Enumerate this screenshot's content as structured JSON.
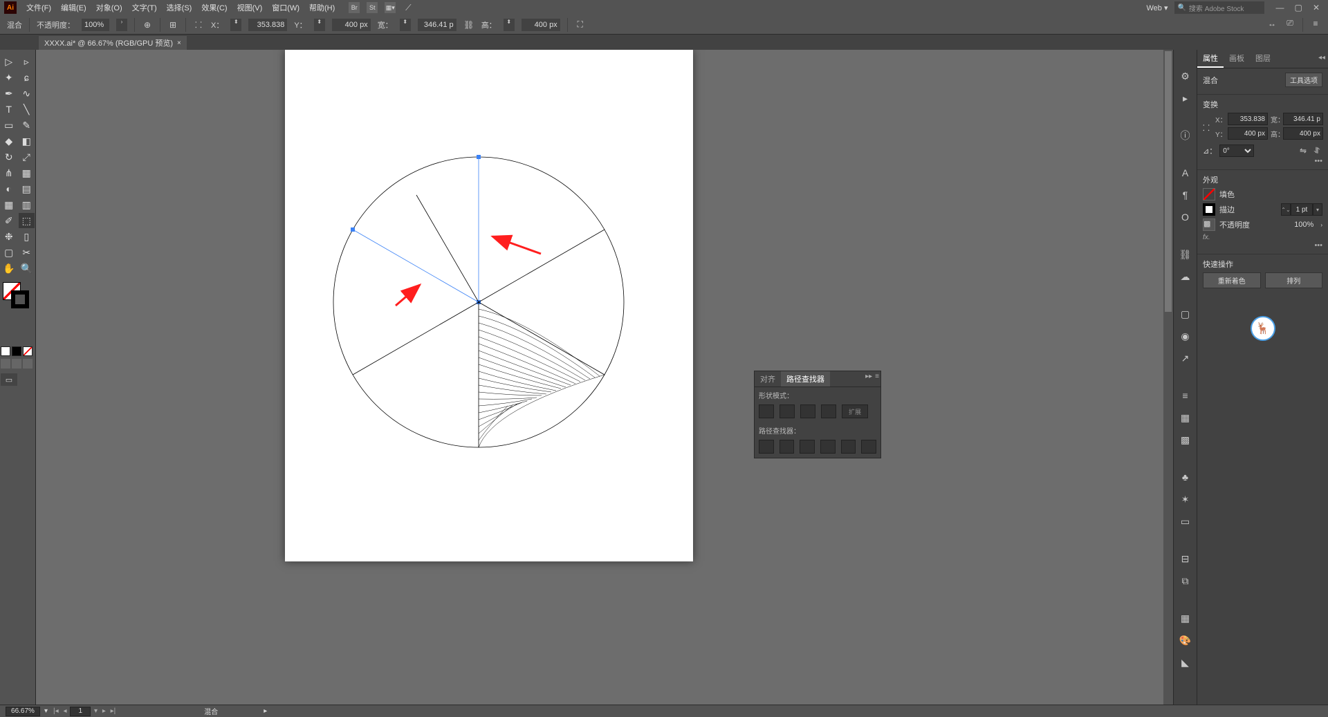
{
  "menubar": [
    "文件(F)",
    "编辑(E)",
    "对象(O)",
    "文字(T)",
    "选择(S)",
    "效果(C)",
    "视图(V)",
    "窗口(W)",
    "帮助(H)"
  ],
  "titlebar_right": {
    "workspace": "Web",
    "search_placeholder": "搜索 Adobe Stock"
  },
  "options": {
    "tool": "混合",
    "opacity_label": "不透明度：",
    "opacity_value": "100%",
    "x_label": "X：",
    "x": "353.838",
    "y_label": "Y：",
    "y": "400 px",
    "w_label": "宽：",
    "w": "346.41 p",
    "h_label": "高：",
    "h": "400 px"
  },
  "doc_tab": {
    "name": "XXXX.ai* @ 66.67% (RGB/GPU 预览)"
  },
  "right_tabs": [
    "属性",
    "画板",
    "图层"
  ],
  "props": {
    "sel_type": "混合",
    "tool_options": "工具选项",
    "transform": {
      "heading": "变换",
      "x_label": "X：",
      "x": "353.838",
      "y_label": "Y：",
      "y": "400 px",
      "w_label": "宽：",
      "w": "346.41 p",
      "h_label": "高：",
      "h": "400 px",
      "angle_label": "⊿：",
      "angle": "0°"
    },
    "appearance": {
      "heading": "外观",
      "fill_label": "填色",
      "stroke_label": "描边",
      "stroke_value": "1 pt",
      "opacity_label": "不透明度",
      "opacity_value": "100%",
      "fx": "fx."
    },
    "quick": {
      "heading": "快速操作",
      "recolor": "重新着色",
      "arrange": "排列"
    }
  },
  "pathfinder": {
    "tab_align": "对齐",
    "tab_pf": "路径查找器",
    "shape_modes": "形状模式：",
    "expand": "扩展",
    "pf_label": "路径查找器："
  },
  "status": {
    "zoom": "66.67%",
    "page": "1",
    "tool": "混合"
  }
}
